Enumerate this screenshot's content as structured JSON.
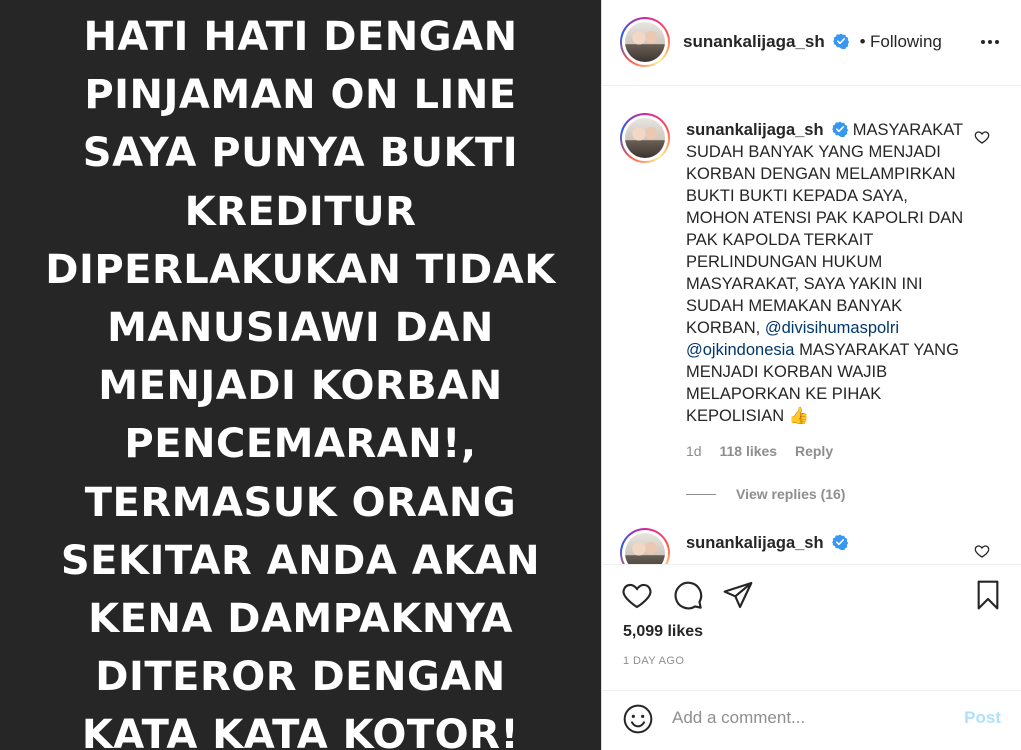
{
  "image": {
    "text_lines": [
      "HATI HATI DENGAN",
      "PINJAMAN ON LINE",
      "SAYA PUNYA BUKTI",
      "KREDITUR",
      "DIPERLAKUKAN TIDAK",
      "MANUSIAWI DAN",
      "MENJADI KORBAN",
      "PENCEMARAN!,",
      "TERMASUK ORANG",
      "SEKITAR ANDA AKAN",
      "KENA DAMPAKNYA",
      "DITEROR DENGAN",
      "KATA KATA KOTOR!"
    ]
  },
  "header": {
    "username": "sunankalijaga_sh",
    "separator": "•",
    "follow_status": "Following",
    "more_icon": "more-horizontal-icon"
  },
  "caption": {
    "username": "sunankalijaga_sh",
    "text_before": "MASYARAKAT SUDAH BANYAK YANG MENJADI KORBAN DENGAN MELAMPIRKAN BUKTI BUKTI KEPADA SAYA, MOHON ATENSI PAK KAPOLRI DAN PAK KAPOLDA TERKAIT PERLINDUNGAN HUKUM MASYARAKAT, SAYA YAKIN INI SUDAH MEMAKAN BANYAK KORBAN,",
    "mention1": "@divisihumaspolri",
    "mention2": "@ojkindonesia",
    "text_after": "MASYARAKAT YANG MENJADI KORBAN WAJIB MELAPORKAN KE PIHAK KEPOLISIAN",
    "emoji": "👍",
    "age": "1d",
    "likes": "118 likes",
    "reply": "Reply",
    "view_replies": "View replies (16)"
  },
  "second_comment": {
    "username": "sunankalijaga_sh"
  },
  "actions": {
    "likes": "5,099 likes",
    "time_ago": "1 DAY AGO"
  },
  "comment_box": {
    "placeholder": "Add a comment...",
    "post_label": "Post",
    "emoji_icon": "smiley-icon"
  },
  "colors": {
    "image_bg": "#262626",
    "verified": "#3897f0",
    "mention": "#00376b",
    "post_disabled": "#b2dffc"
  }
}
